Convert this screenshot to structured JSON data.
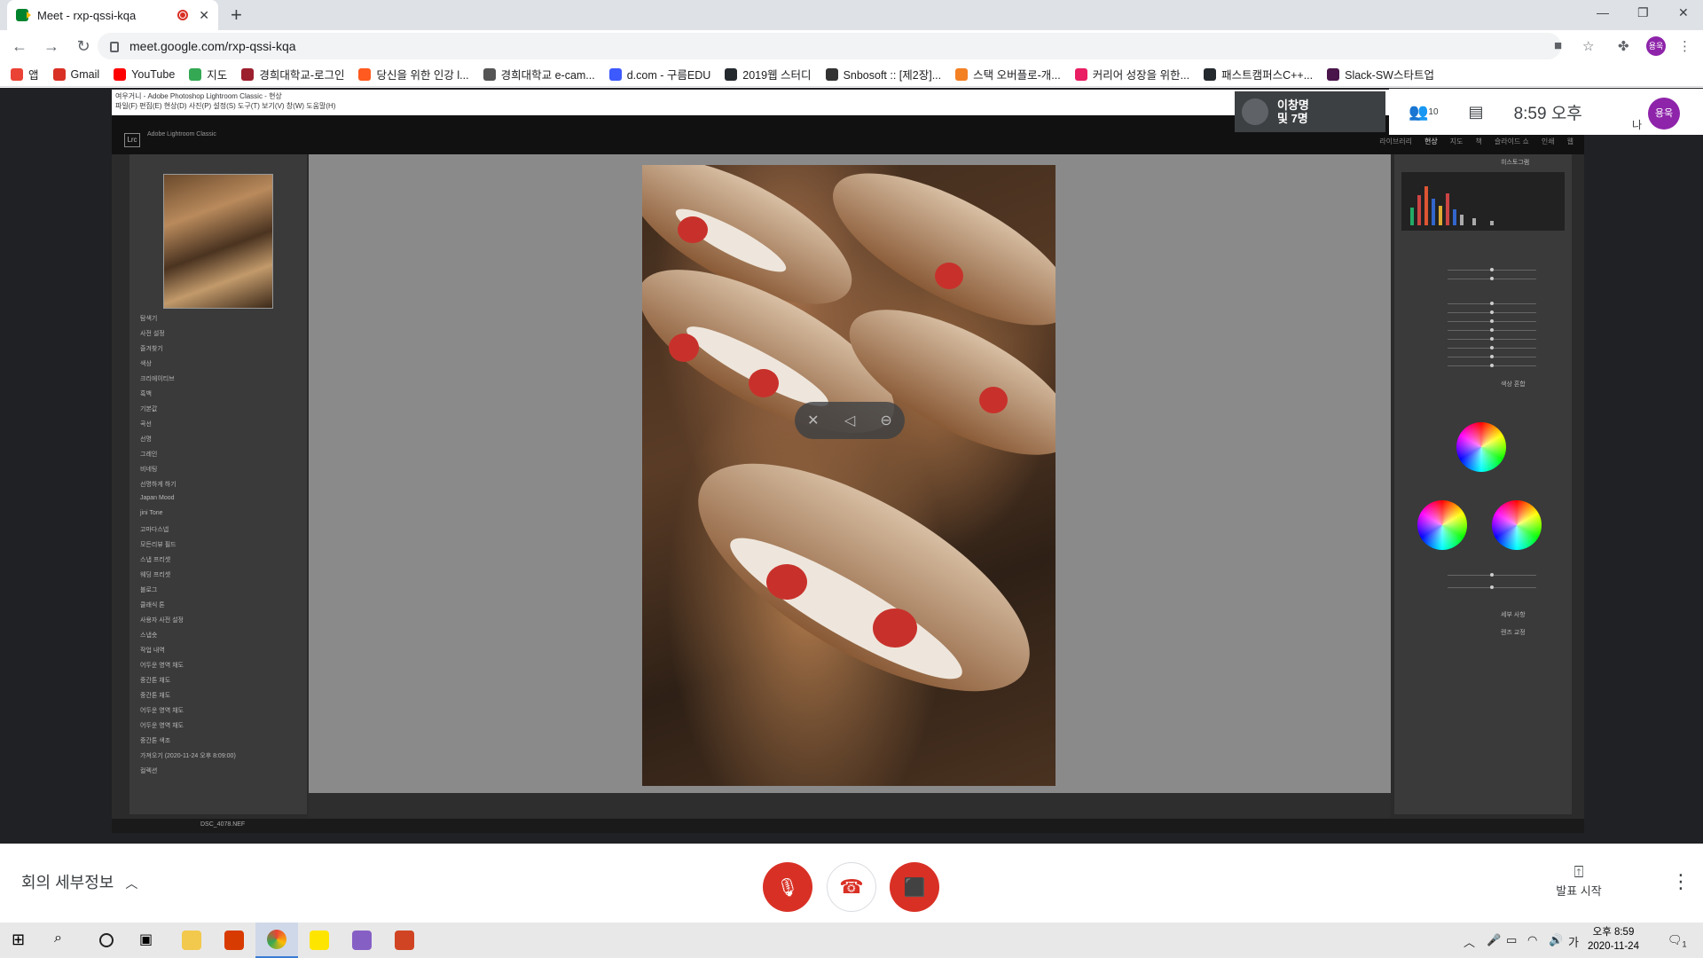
{
  "browser": {
    "tab_title": "Meet - rxp-qssi-kqa",
    "url": "meet.google.com/rxp-qssi-kqa",
    "profile_initials": "용욱"
  },
  "bookmarks": [
    {
      "label": "앱",
      "color": "#ea4335"
    },
    {
      "label": "Gmail",
      "color": "#d93025"
    },
    {
      "label": "YouTube",
      "color": "#ff0000"
    },
    {
      "label": "지도",
      "color": "#34a853"
    },
    {
      "label": "경희대학교-로그인",
      "color": "#9c1f2e"
    },
    {
      "label": "당신을 위한 인강 l...",
      "color": "#ff5a1f"
    },
    {
      "label": "경희대학교 e-cam...",
      "color": "#555555"
    },
    {
      "label": "d.com - 구름EDU",
      "color": "#3d5afe"
    },
    {
      "label": "2019웹 스터디",
      "color": "#24292e"
    },
    {
      "label": "Snbosoft :: [제2장]...",
      "color": "#333333"
    },
    {
      "label": "스택 오버플로-개...",
      "color": "#f48024"
    },
    {
      "label": "커리어 성장을 위한...",
      "color": "#e91e63"
    },
    {
      "label": "패스트캠퍼스C++...",
      "color": "#24292e"
    },
    {
      "label": "Slack-SW스타트업",
      "color": "#4a154b"
    }
  ],
  "lightroom": {
    "menu_title": "여우거니 - Adobe Photoshop Lightroom Classic - 현상",
    "menu_items": "파일(F)  편집(E)  현상(D)  사진(P)  설정(S)  도구(T)  보기(V)  창(W)  도움말(H)",
    "app_name": "Adobe Lightroom Classic",
    "modules": [
      "라이브러리",
      "현상",
      "지도",
      "책",
      "슬라이드 쇼",
      "인쇄",
      "웹"
    ],
    "left_items": [
      "탐색기",
      "사전 설정",
      "즐겨찾기",
      "색상",
      "크리에이티브",
      "흑백",
      "기본값",
      "곡선",
      "선명",
      "그레인",
      "비네팅",
      "선명하게 하기",
      "Japan Mood",
      "jini Tone",
      "고마다스넵",
      "모든리뷰 필드",
      "스냅 프리셋",
      "웨딩 프리셋",
      "블로그",
      "클래식 톤",
      "사용자 사전 설정",
      "스냅숏",
      "작업 내역",
      "어두운 영역 채도",
      "중간톤 채도",
      "중간톤 채도",
      "어두운 영역 채도",
      "어두운 영역 채도",
      "중간톤 색조",
      "가져오기 (2020-11-24 오후 8:09:00)",
      "컬렉션"
    ],
    "filename": "DSC_4078.NEF",
    "right_labels": [
      "히스토그램",
      "색상 혼합",
      "세부 사항",
      "렌즈 교정"
    ]
  },
  "meet": {
    "presenter_name": "이창명",
    "presenter_sub": "및 7명",
    "participant_count": "10",
    "time": "8:59 오후",
    "self_label": "나",
    "self_initials": "용욱",
    "meeting_details": "회의 세부정보",
    "present_label": "발표 시작"
  },
  "taskbar": {
    "clock_time": "오후 8:59",
    "clock_date": "2020-11-24",
    "ime": "가",
    "notif_count": "1"
  }
}
